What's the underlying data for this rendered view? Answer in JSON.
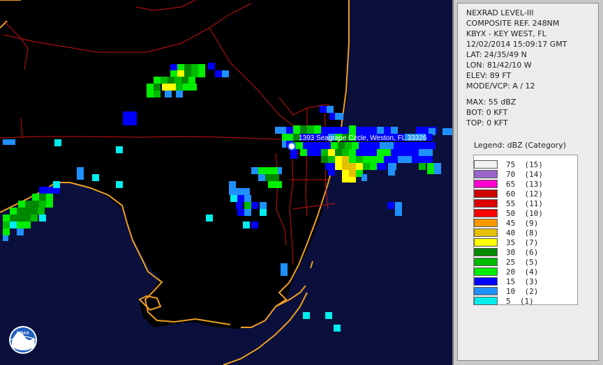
{
  "info": {
    "product": "NEXRAD LEVEL-III",
    "type": "COMPOSITE REF. 248NM",
    "station": "KBYX - KEY WEST, FL",
    "datetime": "12/02/2014 15:09:17 GMT",
    "lat": "LAT: 24/35/49 N",
    "lon": "LON: 81/42/10 W",
    "elev": "ELEV: 89 FT",
    "mode": "MODE/VCP: A / 12",
    "max": "MAX: 55 dBZ",
    "bot": "BOT: 0 KFT",
    "top": "TOP: 0 KFT"
  },
  "legend": {
    "title": "Legend: dBZ (Category)",
    "items": [
      {
        "label": "75  (15)",
        "color": "#f2f2f2"
      },
      {
        "label": "70  (14)",
        "color": "#9966cc"
      },
      {
        "label": "65  (13)",
        "color": "#ff00cc"
      },
      {
        "label": "60  (12)",
        "color": "#cc0000"
      },
      {
        "label": "55  (11)",
        "color": "#dd0000"
      },
      {
        "label": "50  (10)",
        "color": "#ff0000"
      },
      {
        "label": "45  (9)",
        "color": "#ff9900"
      },
      {
        "label": "40  (8)",
        "color": "#e6c000"
      },
      {
        "label": "35  (7)",
        "color": "#ffff00"
      },
      {
        "label": "30  (6)",
        "color": "#008800"
      },
      {
        "label": "25  (5)",
        "color": "#00bb00"
      },
      {
        "label": "20  (4)",
        "color": "#00ee00"
      },
      {
        "label": "15  (3)",
        "color": "#0000ff"
      },
      {
        "label": "10  (2)",
        "color": "#1e90ff"
      },
      {
        "label": "5  (1)",
        "color": "#00eeee"
      }
    ]
  },
  "map": {
    "marker_label": "1393 Seagrape Circle, Weston, FL 33326",
    "logo_text": "NOAA",
    "colors": {
      "ocean": "#0a0f3c",
      "land": "#000000",
      "coast": "#f0a020",
      "roads": "#cc1111"
    }
  }
}
